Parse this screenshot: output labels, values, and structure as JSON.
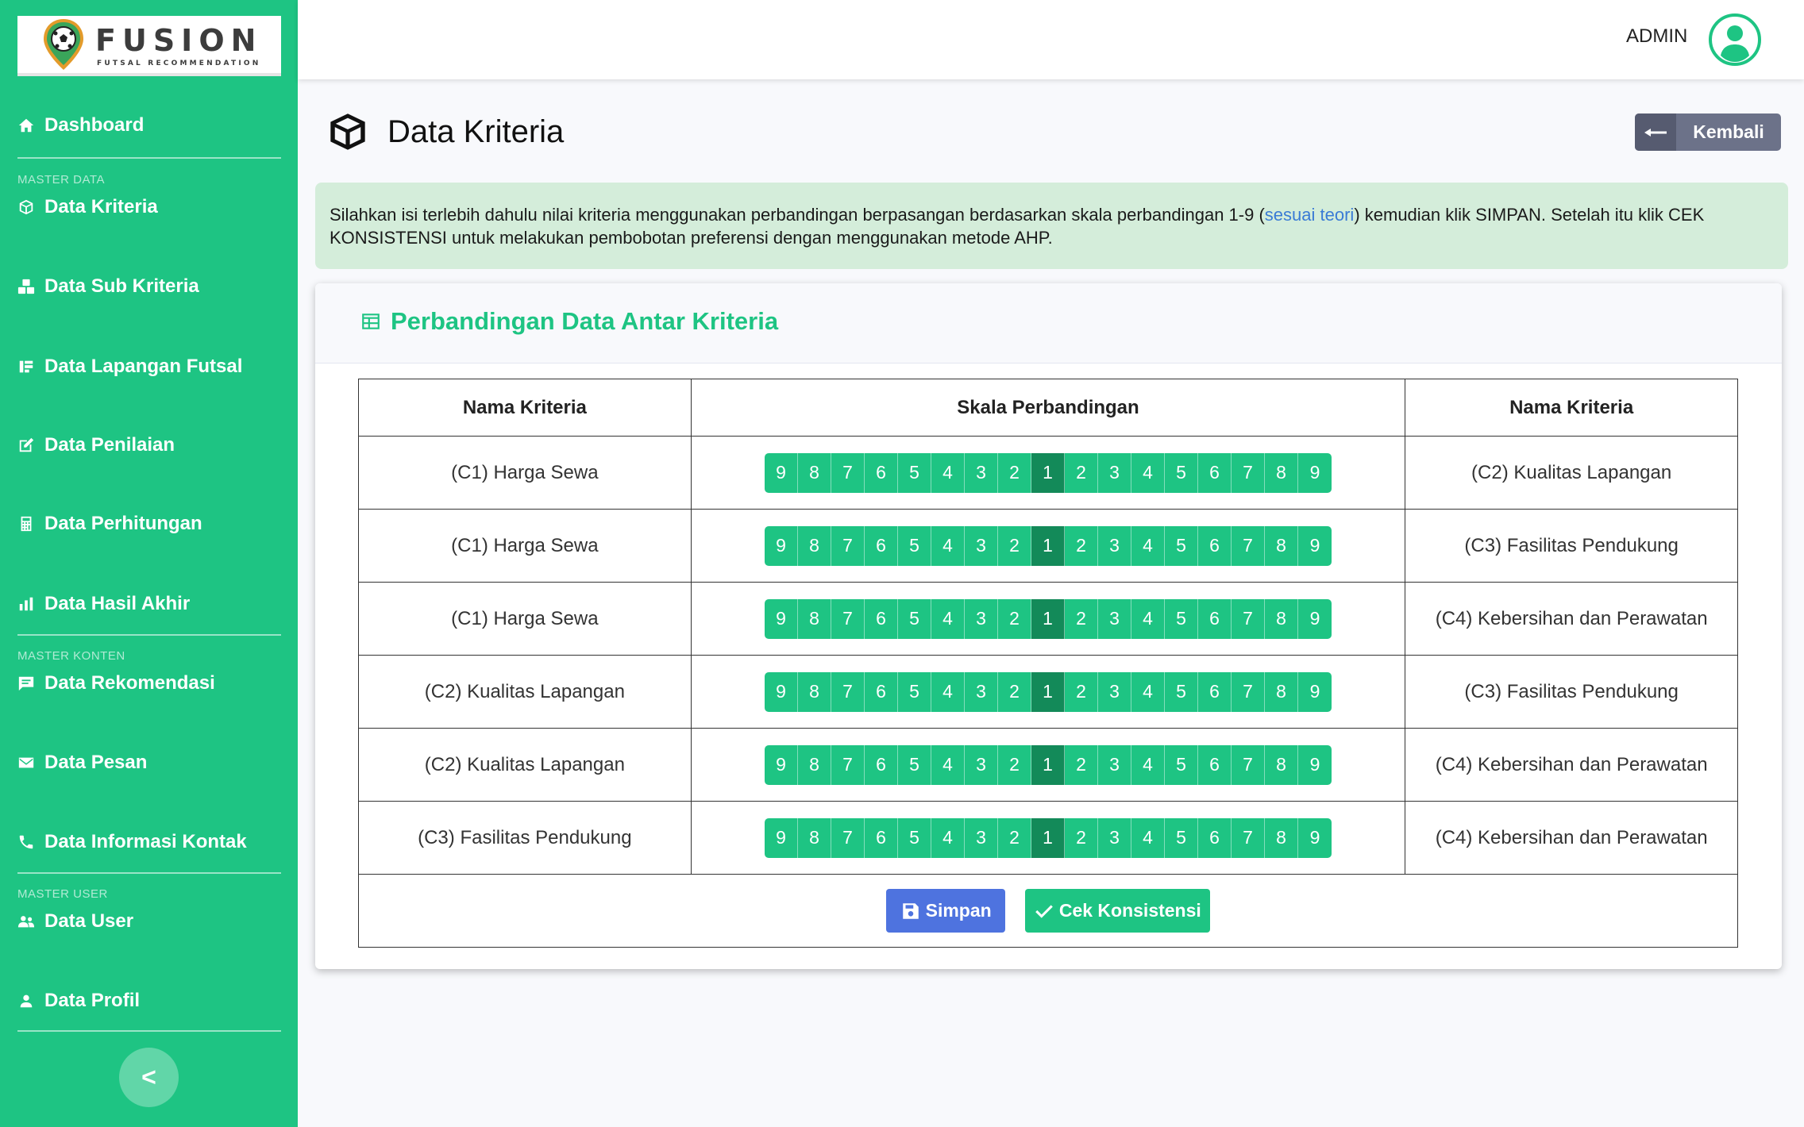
{
  "app": {
    "logo_title": "FUSION",
    "logo_subtitle": "FUTSAL RECOMMENDATION"
  },
  "sidebar": {
    "items": [
      {
        "label": "Dashboard",
        "icon": "home-icon"
      },
      {
        "label": "Data Kriteria",
        "icon": "cube-icon"
      },
      {
        "label": "Data Sub Kriteria",
        "icon": "cubes-icon"
      },
      {
        "label": "Data Lapangan Futsal",
        "icon": "list-icon"
      },
      {
        "label": "Data Penilaian",
        "icon": "edit-icon"
      },
      {
        "label": "Data Perhitungan",
        "icon": "calculator-icon"
      },
      {
        "label": "Data Hasil Akhir",
        "icon": "chart-bar-icon"
      },
      {
        "label": "Data Rekomendasi",
        "icon": "comment-icon"
      },
      {
        "label": "Data Pesan",
        "icon": "envelope-icon"
      },
      {
        "label": "Data Informasi Kontak",
        "icon": "phone-icon"
      },
      {
        "label": "Data User",
        "icon": "users-icon"
      },
      {
        "label": "Data Profil",
        "icon": "user-icon"
      }
    ],
    "sections": {
      "master_data": "MASTER DATA",
      "master_konten": "MASTER KONTEN",
      "master_user": "MASTER USER"
    },
    "toggle_label": "<"
  },
  "topbar": {
    "user_name": "ADMIN"
  },
  "page": {
    "title": "Data Kriteria",
    "back_label": "Kembali"
  },
  "alert": {
    "text_before": "Silahkan isi terlebih dahulu nilai kriteria menggunakan perbandingan berpasangan berdasarkan skala perbandingan 1-9 (",
    "link": "sesuai teori",
    "text_after": ") kemudian klik SIMPAN. Setelah itu klik CEK KONSISTENSI untuk melakukan pembobotan preferensi dengan menggunakan metode AHP."
  },
  "card": {
    "title": "Perbandingan Data Antar Kriteria"
  },
  "table": {
    "headers": [
      "Nama Kriteria",
      "Skala Perbandingan",
      "Nama Kriteria"
    ],
    "scale": [
      "9",
      "8",
      "7",
      "6",
      "5",
      "4",
      "3",
      "2",
      "1",
      "2",
      "3",
      "4",
      "5",
      "6",
      "7",
      "8",
      "9"
    ],
    "rows": [
      {
        "left": "(C1) Harga Sewa",
        "right": "(C2) Kualitas Lapangan",
        "selected": 8
      },
      {
        "left": "(C1) Harga Sewa",
        "right": "(C3) Fasilitas Pendukung",
        "selected": 8
      },
      {
        "left": "(C1) Harga Sewa",
        "right": "(C4) Kebersihan dan Perawatan",
        "selected": 8
      },
      {
        "left": "(C2) Kualitas Lapangan",
        "right": "(C3) Fasilitas Pendukung",
        "selected": 8
      },
      {
        "left": "(C2) Kualitas Lapangan",
        "right": "(C4) Kebersihan dan Perawatan",
        "selected": 8
      },
      {
        "left": "(C3) Fasilitas Pendukung",
        "right": "(C4) Kebersihan dan Perawatan",
        "selected": 8
      }
    ],
    "save_label": "Simpan",
    "check_label": "Cek Konsistensi"
  },
  "colors": {
    "primary": "#1ec483",
    "selected": "#138a59",
    "save_button": "#4e73df",
    "back_button": "#6c7289"
  }
}
